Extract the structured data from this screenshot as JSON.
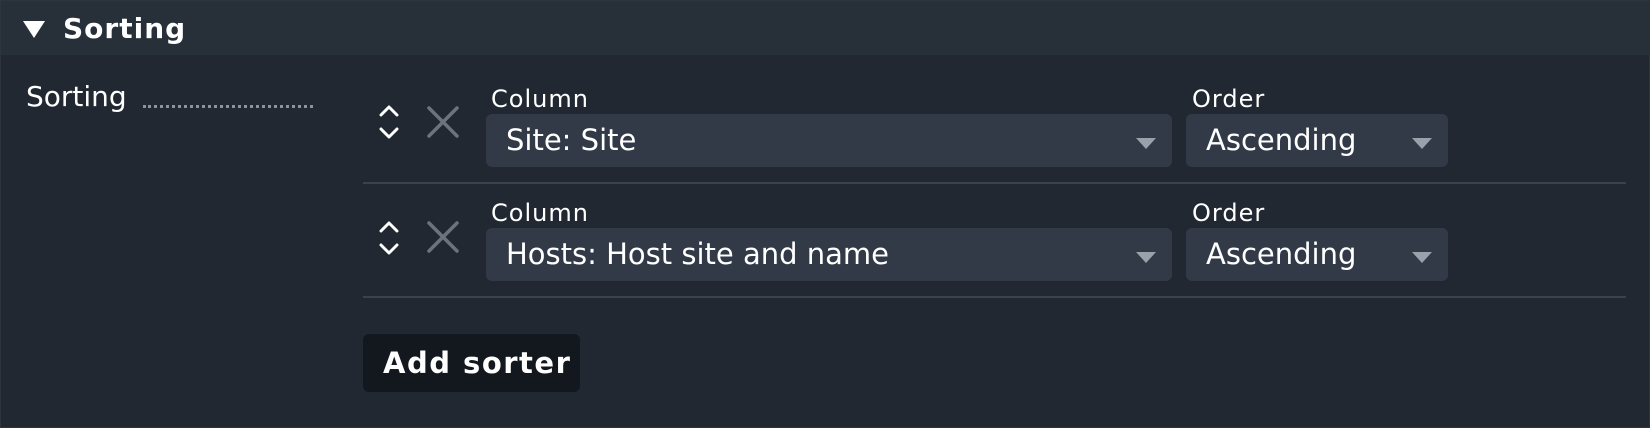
{
  "section": {
    "title": "Sorting",
    "expanded": true
  },
  "form": {
    "label": "Sorting",
    "sorters": [
      {
        "column_label": "Column",
        "column_value": "Site: Site",
        "order_label": "Order",
        "order_value": "Ascending"
      },
      {
        "column_label": "Column",
        "column_value": "Hosts: Host site and name",
        "order_label": "Order",
        "order_value": "Ascending"
      }
    ],
    "add_button_label": "Add sorter"
  },
  "icons": {
    "toggle": "triangle-down-icon",
    "move_up": "chevron-up-icon",
    "move_down": "chevron-down-icon",
    "remove": "close-icon",
    "dropdown": "dropdown-arrow-icon"
  },
  "colors": {
    "background": "#212831",
    "header": "#272f39",
    "select_bg": "#323a48",
    "button_bg": "#13181e",
    "icon_gray": "#6b737d"
  }
}
